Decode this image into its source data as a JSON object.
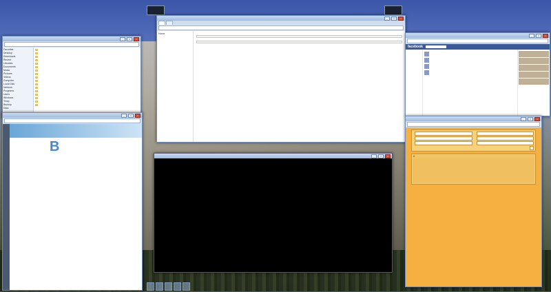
{
  "desktop": {
    "accent": "#3b5998",
    "taskbar_icons": [
      "firefox",
      "terminal",
      "folder",
      "pdf",
      "db"
    ]
  },
  "thumbnails": {
    "left_label": "",
    "right_label": ""
  },
  "explorer": {
    "title": "",
    "address": "",
    "sidebar": [
      "Favorites",
      "Desktop",
      "Downloads",
      "Recent",
      "Libraries",
      "Documents",
      "Music",
      "Pictures",
      "Videos",
      "Computer",
      "Local Disk",
      "Network",
      "Programs",
      "Users",
      "Windows",
      "Temp",
      "Backup",
      "Data"
    ],
    "rows": [
      {
        "name": "",
        "date": "",
        "type": ""
      },
      {
        "name": "",
        "date": "",
        "type": ""
      },
      {
        "name": "",
        "date": "",
        "type": ""
      },
      {
        "name": "",
        "date": "",
        "type": ""
      },
      {
        "name": "",
        "date": "",
        "type": ""
      },
      {
        "name": "",
        "date": "",
        "type": ""
      },
      {
        "name": "",
        "date": "",
        "type": ""
      },
      {
        "name": "",
        "date": "",
        "type": ""
      },
      {
        "name": "",
        "date": "",
        "type": ""
      },
      {
        "name": "",
        "date": "",
        "type": ""
      },
      {
        "name": "",
        "date": "",
        "type": ""
      },
      {
        "name": "",
        "date": "",
        "type": ""
      },
      {
        "name": "",
        "date": "",
        "type": ""
      },
      {
        "name": "",
        "date": "",
        "type": ""
      },
      {
        "name": "",
        "date": "",
        "type": ""
      },
      {
        "name": "",
        "date": "",
        "type": ""
      },
      {
        "name": "",
        "date": "",
        "type": ""
      }
    ]
  },
  "pdf": {
    "title": "",
    "letter": "B",
    "entries": [
      {
        "term": "",
        "detail": ""
      },
      {
        "term": "",
        "detail": ""
      },
      {
        "term": "",
        "detail": ""
      },
      {
        "term": "",
        "detail": ""
      },
      {
        "term": "",
        "detail": ""
      },
      {
        "term": "",
        "detail": ""
      },
      {
        "term": "",
        "detail": ""
      },
      {
        "term": "",
        "detail": ""
      },
      {
        "term": "",
        "detail": ""
      },
      {
        "term": "",
        "detail": ""
      },
      {
        "term": "",
        "detail": ""
      },
      {
        "term": "",
        "detail": ""
      },
      {
        "term": "",
        "detail": ""
      },
      {
        "term": "",
        "detail": ""
      },
      {
        "term": "",
        "detail": ""
      },
      {
        "term": "",
        "detail": ""
      },
      {
        "term": "",
        "detail": ""
      },
      {
        "term": "",
        "detail": ""
      },
      {
        "term": "",
        "detail": ""
      },
      {
        "term": "",
        "detail": ""
      },
      {
        "term": "",
        "detail": ""
      },
      {
        "term": "",
        "detail": ""
      },
      {
        "term": "",
        "detail": ""
      },
      {
        "term": "",
        "detail": ""
      }
    ]
  },
  "doc": {
    "title": "",
    "address": "",
    "tabs": [
      "",
      ""
    ],
    "sidebar": [
      "Home",
      "",
      ""
    ],
    "heading1": "",
    "intro": "",
    "heading2": "",
    "para2": "",
    "code1": "",
    "heading3": "",
    "para3": "",
    "code2": "",
    "address2": ""
  },
  "terminal": {
    "title": "",
    "lines": [
      "",
      "",
      "",
      "",
      "",
      "",
      "",
      "",
      "",
      "",
      "",
      "",
      "",
      "",
      "",
      "",
      "",
      "",
      "",
      "",
      "",
      "",
      "",
      "",
      "",
      "",
      "",
      "",
      "",
      "",
      "",
      "",
      "",
      "",
      "",
      "",
      "",
      "",
      "",
      ""
    ]
  },
  "facebook": {
    "title": "",
    "address": "",
    "logo": "facebook",
    "left_menu": [
      "",
      "",
      "",
      "",
      "",
      "",
      "",
      "",
      "",
      "",
      "",
      "",
      "",
      ""
    ],
    "posts": [
      {
        "author": "",
        "text": ""
      },
      {
        "author": "",
        "text": ""
      },
      {
        "author": "",
        "text": ""
      },
      {
        "author": "",
        "text": ""
      }
    ],
    "right_items": [
      "",
      "",
      "",
      "",
      ""
    ]
  },
  "database": {
    "title": "",
    "address": "",
    "form_labels": [
      "",
      "",
      "",
      "",
      "",
      ""
    ],
    "button": "",
    "columns": [
      "#",
      "",
      "",
      "",
      "",
      "",
      "",
      "",
      ""
    ],
    "rows": [
      [
        "",
        "",
        "",
        "",
        "",
        "",
        "",
        "",
        ""
      ],
      [
        "",
        "",
        "",
        "",
        "",
        "",
        "",
        "",
        ""
      ],
      [
        "",
        "",
        "",
        "",
        "",
        "",
        "",
        "",
        ""
      ],
      [
        "",
        "",
        "",
        "",
        "",
        "",
        "",
        "",
        ""
      ],
      [
        "",
        "",
        "",
        "",
        "",
        "",
        "",
        "",
        ""
      ],
      [
        "",
        "",
        "",
        "",
        "",
        "",
        "",
        "",
        ""
      ],
      [
        "",
        "",
        "",
        "",
        "",
        "",
        "",
        "",
        ""
      ],
      [
        "",
        "",
        "",
        "",
        "",
        "",
        "",
        "",
        ""
      ],
      [
        "",
        "",
        "",
        "",
        "",
        "",
        "",
        "",
        ""
      ],
      [
        "",
        "",
        "",
        "",
        "",
        "",
        "",
        "",
        ""
      ],
      [
        "",
        "",
        "",
        "",
        "",
        "",
        "",
        "",
        ""
      ],
      [
        "",
        "",
        "",
        "",
        "",
        "",
        "",
        "",
        ""
      ],
      [
        "",
        "",
        "",
        "",
        "",
        "",
        "",
        "",
        ""
      ],
      [
        "",
        "",
        "",
        "",
        "",
        "",
        "",
        "",
        ""
      ],
      [
        "",
        "",
        "",
        "",
        "",
        "",
        "",
        "",
        ""
      ],
      [
        "",
        "",
        "",
        "",
        "",
        "",
        "",
        "",
        ""
      ],
      [
        "",
        "",
        "",
        "",
        "",
        "",
        "",
        "",
        ""
      ],
      [
        "",
        "",
        "",
        "",
        "",
        "",
        "",
        "",
        ""
      ],
      [
        "",
        "",
        "",
        "",
        "",
        "",
        "",
        "",
        ""
      ],
      [
        "",
        "",
        "",
        "",
        "",
        "",
        "",
        "",
        ""
      ],
      [
        "",
        "",
        "",
        "",
        "",
        "",
        "",
        "",
        ""
      ],
      [
        "",
        "",
        "",
        "",
        "",
        "",
        "",
        "",
        ""
      ],
      [
        "",
        "",
        "",
        "",
        "",
        "",
        "",
        "",
        ""
      ],
      [
        "",
        "",
        "",
        "",
        "",
        "",
        "",
        "",
        ""
      ],
      [
        "",
        "",
        "",
        "",
        "",
        "",
        "",
        "",
        ""
      ],
      [
        "",
        "",
        "",
        "",
        "",
        "",
        "",
        "",
        ""
      ],
      [
        "",
        "",
        "",
        "",
        "",
        "",
        "",
        "",
        ""
      ],
      [
        "",
        "",
        "",
        "",
        "",
        "",
        "",
        "",
        ""
      ],
      [
        "",
        "",
        "",
        "",
        "",
        "",
        "",
        "",
        ""
      ],
      [
        "",
        "",
        "",
        "",
        "",
        "",
        "",
        "",
        ""
      ],
      [
        "",
        "",
        "",
        "",
        "",
        "",
        "",
        "",
        ""
      ],
      [
        "",
        "",
        "",
        "",
        "",
        "",
        "",
        "",
        ""
      ],
      [
        "",
        "",
        "",
        "",
        "",
        "",
        "",
        "",
        ""
      ],
      [
        "",
        "",
        "",
        "",
        "",
        "",
        "",
        "",
        ""
      ],
      [
        "",
        "",
        "",
        "",
        "",
        "",
        "",
        "",
        ""
      ],
      [
        "",
        "",
        "",
        "",
        "",
        "",
        "",
        "",
        ""
      ]
    ]
  }
}
